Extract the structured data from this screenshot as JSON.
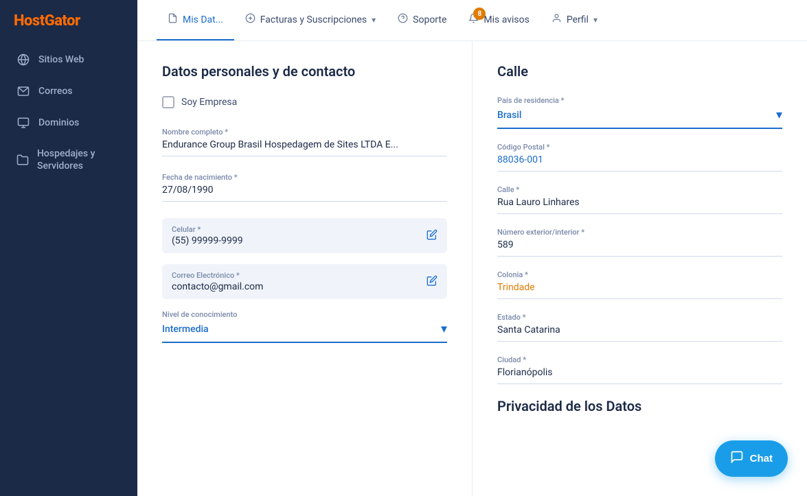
{
  "logo": {
    "text_host": "Host",
    "text_gator": "Gator"
  },
  "sidebar": {
    "items": [
      {
        "id": "sitios-web",
        "label": "Sitios Web",
        "icon": "globe"
      },
      {
        "id": "correos",
        "label": "Correos",
        "icon": "mail"
      },
      {
        "id": "dominios",
        "label": "Dominios",
        "icon": "monitor"
      },
      {
        "id": "hospedajes",
        "label": "Hospedajes y Servidores",
        "icon": "folder"
      }
    ]
  },
  "topnav": {
    "items": [
      {
        "id": "mis-datos",
        "label": "Mis Dat...",
        "icon": "doc",
        "active": true
      },
      {
        "id": "facturas",
        "label": "Facturas y Suscripciones",
        "icon": "dollar",
        "has_chevron": true
      },
      {
        "id": "soporte",
        "label": "Soporte",
        "icon": "question"
      },
      {
        "id": "mis-avisos",
        "label": "Mis avisos",
        "icon": "bell",
        "badge": "8"
      },
      {
        "id": "perfil",
        "label": "Perfil",
        "icon": "user",
        "has_chevron": true
      }
    ]
  },
  "left": {
    "section_title": "Datos personales y de contacto",
    "checkbox_label": "Soy Empresa",
    "fields": [
      {
        "id": "nombre",
        "label": "Nombre completo *",
        "value": "Endurance Group Brasil Hospedagem de Sites LTDA E...",
        "type": "plain"
      },
      {
        "id": "fecha",
        "label": "Fecha de nacimiento *",
        "value": "27/08/1990",
        "type": "plain"
      }
    ],
    "editable_fields": [
      {
        "id": "celular",
        "label": "Celular *",
        "value": "(55) 99999-9999"
      },
      {
        "id": "correo",
        "label": "Correo Electrónico *",
        "value": "contacto@gmail.com"
      }
    ],
    "dropdown_field": {
      "id": "nivel",
      "label": "Nivel de conocimiento",
      "value": "Intermedia"
    }
  },
  "right": {
    "section_title": "Calle",
    "country_label": "País de residencia *",
    "country_value": "Brasil",
    "fields": [
      {
        "id": "codigo-postal",
        "label": "Código Postal *",
        "value": "88036-001",
        "type": "link"
      },
      {
        "id": "calle",
        "label": "Calle *",
        "value": "Rua Lauro Linhares",
        "type": "plain"
      },
      {
        "id": "numero",
        "label": "Número exterior/interior *",
        "value": "589",
        "type": "plain"
      },
      {
        "id": "colonia",
        "label": "Colonia *",
        "value": "Trindade",
        "type": "highlighted"
      },
      {
        "id": "estado",
        "label": "Estado *",
        "value": "Santa Catarina",
        "type": "plain"
      },
      {
        "id": "ciudad",
        "label": "Ciudad *",
        "value": "Florianópolis",
        "type": "plain"
      }
    ],
    "privacy_title": "Privacidad de los Datos"
  },
  "chat": {
    "label": "Chat"
  }
}
